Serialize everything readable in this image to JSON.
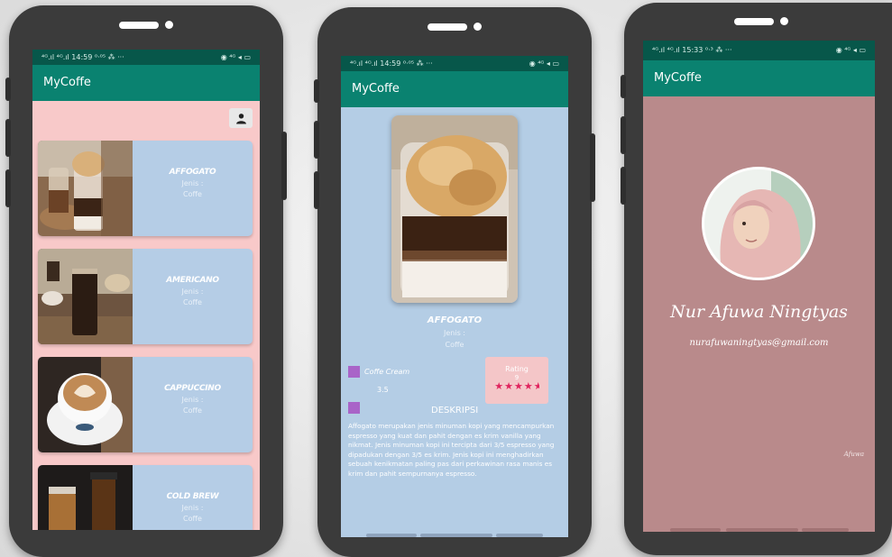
{
  "colors": {
    "phone_body": "#3b3b3b",
    "status_bar": "#07574a",
    "app_bar": "#0a8270",
    "list_bg": "#f8c9c9",
    "card_bg": "#b5cde6",
    "detail_bg": "#b4cde5",
    "profile_bg": "#b98a8b",
    "accent_square": "#a964c8",
    "rating_bg": "#f4c6c8",
    "star": "#e0245e"
  },
  "phone1": {
    "status_left": "⁴ᴳ.ıl ⁴ᴳ.ıl 14:59 ⁰·⁰⁵ ⁂ ···",
    "status_right": "◉ ⁴ᴳ ◂ ▭",
    "app_title": "MyCoffe",
    "profile_icon": "person-icon",
    "items": [
      {
        "title": "AFFOGATO",
        "jenis_label": "Jenis :",
        "jenis_value": "Coffe"
      },
      {
        "title": "AMERICANO",
        "jenis_label": "Jenis :",
        "jenis_value": "Coffe"
      },
      {
        "title": "CAPPUCCINO",
        "jenis_label": "Jenis :",
        "jenis_value": "Coffe"
      },
      {
        "title": "COLD BREW",
        "jenis_label": "Jenis :",
        "jenis_value": "Coffe"
      }
    ]
  },
  "phone2": {
    "status_left": "⁴ᴳ.ıl ⁴ᴳ.ıl 14:59 ⁰·⁰⁵ ⁂ ···",
    "status_right": "◉ ⁴ᴳ ◂ ▭",
    "app_title": "MyCoffe",
    "title": "AFFOGATO",
    "jenis_label": "Jenis :",
    "jenis_value": "Coffe",
    "subtype": "Coffe Cream",
    "price": "3.5",
    "rating_label": "Rating",
    "rating_value": "9",
    "stars": 4.5,
    "desc_heading": "DESKRIPSI",
    "description": "Affogato merupakan jenis minuman kopi yang mencampurkan espresso yang kuat dan pahit dengan es krim vanilla yang nikmat. Jenis minuman kopi ini tercipta dari 3/5 espresso yang dipadukan dengan 3/5 es krim. Jenis kopi ini menghadirkan sebuah kenikmatan paling pas dari perkawinan rasa manis es krim dan pahit sempurnanya espresso."
  },
  "phone3": {
    "status_left": "⁴ᴳ.ıl ⁴ᴳ.ıl 15:33 ⁰·³ ⁂ ···",
    "status_right": "◉ ⁴ᴳ ◂ ▭",
    "app_title": "MyCoffe",
    "name": "Nur Afuwa Ningtyas",
    "email": "nurafuwaningtyas@gmail.com",
    "signature": "Afuwa"
  }
}
